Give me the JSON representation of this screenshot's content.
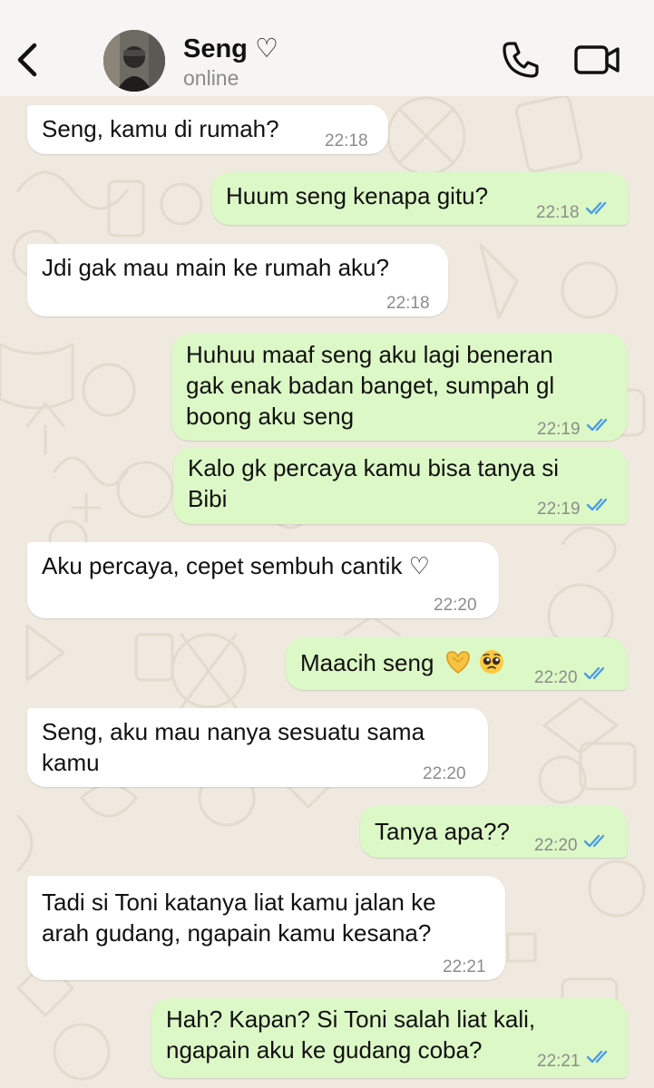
{
  "header": {
    "contact_name": "Seng ♡",
    "status": "online"
  },
  "messages": [
    {
      "from": "contact",
      "lines": [
        "Seng, kamu di rumah?"
      ],
      "time": "22:18"
    },
    {
      "from": "me",
      "lines": [
        "Huum seng kenapa gitu?"
      ],
      "time": "22:18",
      "status": "read"
    },
    {
      "from": "contact",
      "lines": [
        "Jdi gak mau main ke rumah aku?"
      ],
      "time": "22:18"
    },
    {
      "from": "me",
      "lines": [
        "Huhuu maaf seng aku lagi beneran",
        "gak enak badan banget, sumpah gl",
        "boong aku seng"
      ],
      "time": "22:19",
      "status": "read"
    },
    {
      "from": "me",
      "lines": [
        "Kalo gk percaya kamu bisa tanya si",
        "Bibi"
      ],
      "time": "22:19",
      "status": "read"
    },
    {
      "from": "contact",
      "lines": [
        "Aku percaya, cepet sembuh cantik ♡"
      ],
      "time": "22:20"
    },
    {
      "from": "me",
      "lines": [
        "Maacih seng"
      ],
      "emoji": [
        "heart-hands",
        "pleading-face"
      ],
      "time": "22:20",
      "status": "read"
    },
    {
      "from": "contact",
      "lines": [
        "Seng, aku mau nanya sesuatu sama",
        "kamu"
      ],
      "time": "22:20"
    },
    {
      "from": "me",
      "lines": [
        "Tanya apa??"
      ],
      "time": "22:20",
      "status": "read"
    },
    {
      "from": "contact",
      "lines": [
        "Tadi si Toni katanya liat kamu jalan ke",
        "arah gudang, ngapain kamu kesana?"
      ],
      "time": "22:21"
    },
    {
      "from": "me",
      "lines": [
        "Hah? Kapan? Si Toni salah liat kali,",
        "ngapain aku ke gudang coba?"
      ],
      "time": "22:21",
      "status": "read"
    }
  ],
  "colors": {
    "outgoing_bubble": "#dcf8c6",
    "incoming_bubble": "#ffffff",
    "wallpaper": "#efe9df",
    "read_ticks": "#4a9ae8"
  },
  "icons": [
    "back-chevron-icon",
    "voice-call-icon",
    "video-call-icon"
  ]
}
